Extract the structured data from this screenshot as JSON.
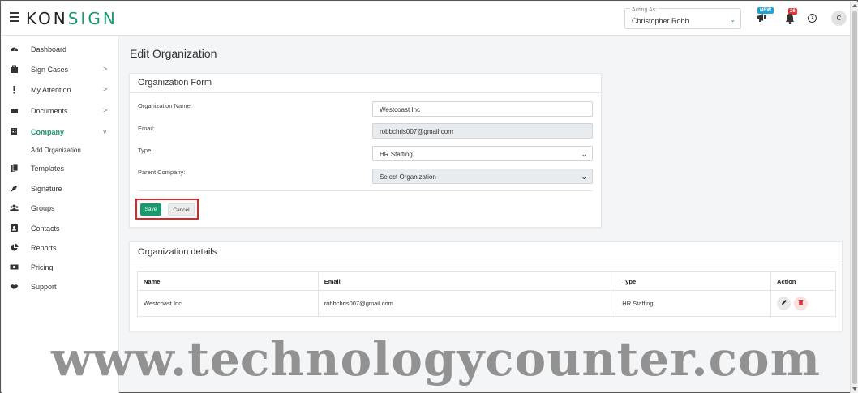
{
  "header": {
    "logo_prefix": "KON",
    "logo_accent": "SIGN",
    "acting_as_label": "Acting As:",
    "acting_as_value": "Christopher Robb",
    "new_badge": "NEW",
    "notification_count": "26",
    "help_glyph": "?",
    "avatar_initial": "C"
  },
  "sidebar": {
    "items": [
      {
        "label": "Dashboard",
        "icon": "dashboard-icon"
      },
      {
        "label": "Sign Cases",
        "icon": "briefcase-icon",
        "chevron": ">"
      },
      {
        "label": "My Attention",
        "icon": "exclamation-icon",
        "chevron": ">"
      },
      {
        "label": "Documents",
        "icon": "folder-icon",
        "chevron": ">"
      },
      {
        "label": "Company",
        "icon": "building-icon",
        "chevron": "v"
      },
      {
        "label": "Templates",
        "icon": "copy-icon"
      },
      {
        "label": "Signature",
        "icon": "pen-icon"
      },
      {
        "label": "Groups",
        "icon": "users-icon"
      },
      {
        "label": "Contacts",
        "icon": "contact-icon"
      },
      {
        "label": "Reports",
        "icon": "pie-chart-icon"
      },
      {
        "label": "Pricing",
        "icon": "money-icon"
      },
      {
        "label": "Support",
        "icon": "handshake-icon"
      }
    ],
    "sub_item": "Add Organization"
  },
  "page": {
    "title": "Edit Organization"
  },
  "form": {
    "title": "Organization Form",
    "name_label": "Organization Name:",
    "name_value": "Westcoast Inc",
    "email_label": "Email:",
    "email_value": "robbchris007@gmail.com",
    "type_label": "Type:",
    "type_value": "HR Staffing",
    "parent_label": "Parent Company:",
    "parent_value": "Select Organization",
    "save_label": "Save",
    "cancel_label": "Cancel"
  },
  "details": {
    "title": "Organization details",
    "columns": [
      "Name",
      "Email",
      "Type",
      "Action"
    ],
    "rows": [
      {
        "name": "Westcoast Inc",
        "email": "robbchris007@gmail.com",
        "type": "HR Staffing"
      }
    ]
  },
  "watermark": "www.technologycounter.com",
  "colors": {
    "brand": "#1a9a6c",
    "highlight": "#e02424",
    "delete": "#d9363e"
  }
}
